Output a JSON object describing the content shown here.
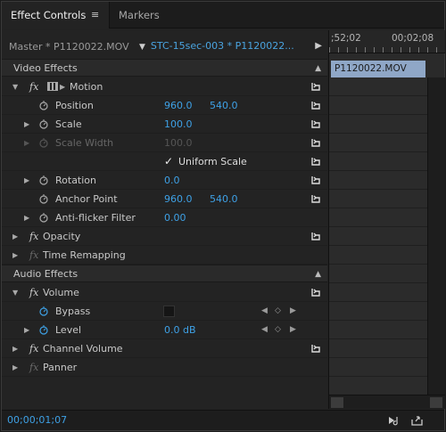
{
  "tabs": [
    {
      "label": "Effect Controls",
      "active": true,
      "menu_glyph": "≡"
    },
    {
      "label": "Markers",
      "active": false
    }
  ],
  "header": {
    "master_clip": "Master * P1120022.MOV",
    "sequence_clip": "STC-15sec-003 * P1120022...",
    "dropdown_glyph": "▼",
    "expand_glyph": "▶"
  },
  "timeline": {
    "ruler_left": ";52;02",
    "ruler_right": "00;02;08",
    "clip_name": "P1120022.MOV"
  },
  "sections": {
    "video": "Video Effects",
    "audio": "Audio Effects"
  },
  "motion": {
    "name": "Motion",
    "position": {
      "label": "Position",
      "x": "960.0",
      "y": "540.0"
    },
    "scale": {
      "label": "Scale",
      "value": "100.0"
    },
    "scale_width": {
      "label": "Scale Width",
      "value": "100.0"
    },
    "uniform_scale": {
      "label": "Uniform Scale",
      "checked": true
    },
    "rotation": {
      "label": "Rotation",
      "value": "0.0"
    },
    "anchor_point": {
      "label": "Anchor Point",
      "x": "960.0",
      "y": "540.0"
    },
    "anti_flicker": {
      "label": "Anti-flicker Filter",
      "value": "0.00"
    }
  },
  "opacity": {
    "name": "Opacity"
  },
  "time_remapping": {
    "name": "Time Remapping"
  },
  "volume": {
    "name": "Volume",
    "bypass": {
      "label": "Bypass"
    },
    "level": {
      "label": "Level",
      "value": "0.0 dB"
    }
  },
  "channel_volume": {
    "name": "Channel Volume"
  },
  "panner": {
    "name": "Panner"
  },
  "footer": {
    "timecode": "00;00;01;07"
  },
  "colors": {
    "accent": "#3ea1e6",
    "clip": "#8fa7c7",
    "panel": "#232323"
  }
}
